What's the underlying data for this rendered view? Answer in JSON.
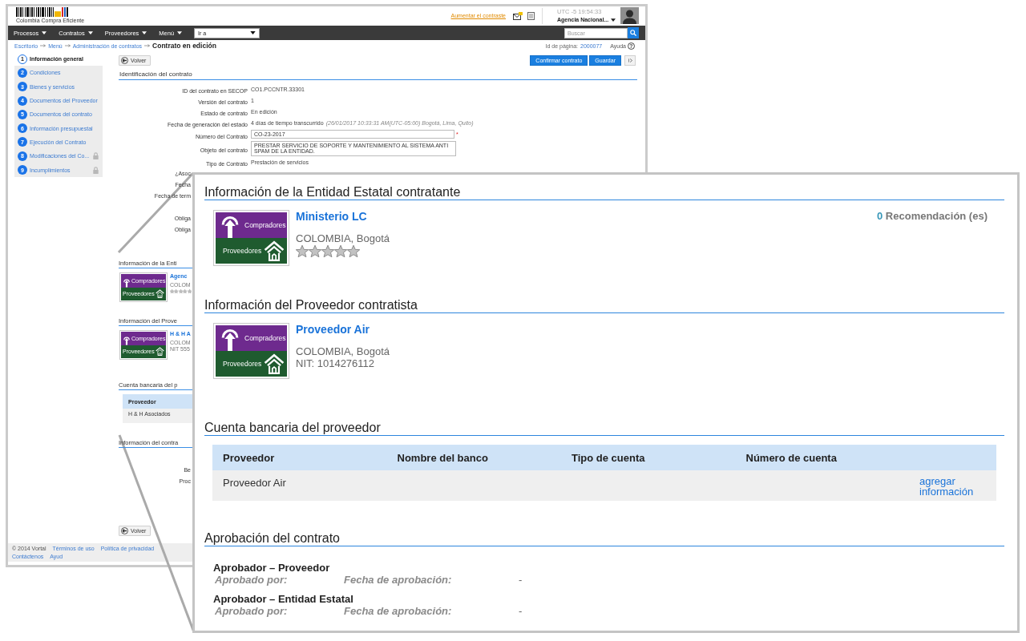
{
  "header": {
    "logo_caption": "Colombia Compra Eficiente",
    "contrast_link": "Aumentar el contraste",
    "clock": "UTC -5 19:54:33",
    "user": "Agencia Nacional..."
  },
  "nav": {
    "menus": [
      "Procesos",
      "Contratos",
      "Proveedores",
      "Menú"
    ],
    "goto": {
      "value": "Ir a"
    },
    "search": {
      "placeholder": "Buscar"
    }
  },
  "breadcrumb": {
    "links": [
      "Escritorio",
      "Menú",
      "Administración de contratos"
    ],
    "current": "Contrato en edición",
    "page_id_label": "Id de página:",
    "page_id": "2000077",
    "help": {
      "label": "Ayuda",
      "icon": "?"
    }
  },
  "sidebar": {
    "items": [
      {
        "number": "1",
        "label": "Información general",
        "selected": true,
        "locked": false
      },
      {
        "number": "2",
        "label": "Condiciones",
        "selected": false,
        "locked": false
      },
      {
        "number": "3",
        "label": "Bienes y servicios",
        "selected": false,
        "locked": false
      },
      {
        "number": "4",
        "label": "Documentos del Proveedor",
        "selected": false,
        "locked": false
      },
      {
        "number": "5",
        "label": "Documentos del contrato",
        "selected": false,
        "locked": false
      },
      {
        "number": "6",
        "label": "Información presupuestal",
        "selected": false,
        "locked": false
      },
      {
        "number": "7",
        "label": "Ejecución del Contrato",
        "selected": false,
        "locked": false
      },
      {
        "number": "8",
        "label": "Modificaciones del Co...",
        "selected": false,
        "locked": true
      },
      {
        "number": "9",
        "label": "Incumplimientos",
        "selected": false,
        "locked": true
      }
    ]
  },
  "toolbar": {
    "back": "Volver",
    "buttons": [
      {
        "kind": "primary",
        "label": "Confirmar contrato"
      },
      {
        "kind": "primary",
        "label": "Guardar"
      },
      {
        "kind": "menu"
      }
    ]
  },
  "identification": {
    "title": "Identificación del contrato",
    "fields": [
      {
        "kind": "text",
        "label": "ID del contrato en SECOP",
        "value": "CO1.PCCNTR.33301"
      },
      {
        "kind": "text",
        "label": "Versión del contrato",
        "value": "1"
      },
      {
        "kind": "text",
        "label": "Estado de contrato",
        "value": "En edición"
      },
      {
        "kind": "timestamp",
        "label": "Fecha de generación del estado",
        "value": "4 días de tiempo transcurrido",
        "detail": "(26/01/2017 10:33:31 AM(UTC-05:00) Bogotá, Lima, Quito)"
      },
      {
        "kind": "input",
        "label": "Número del Contrato",
        "value": "CO-23-2017",
        "required_mark": "*"
      },
      {
        "kind": "textarea",
        "label": "Objeto del contrato",
        "value": "PRESTAR SERVICIO DE SOPORTE Y MANTENIMIENTO AL SISTEMA ANTI SPAM DE LA ENTIDAD."
      },
      {
        "kind": "text",
        "label": "Tipo de Contrato",
        "value": "Prestación de servicios"
      }
    ],
    "covered_labels": [
      "¿Asoc",
      "Fecha",
      "Fecha de term",
      "Obliga",
      "Obliga"
    ]
  },
  "background_sections": {
    "entity": {
      "title": "Información de la Enti",
      "logo": {
        "top": "Compradores",
        "bottom": "Proveedores"
      },
      "name": "Agenc",
      "location": "COLOM",
      "stars": 0
    },
    "supplier": {
      "title": "Información del Prove",
      "logo": {
        "top": "Compradores",
        "bottom": "Proveedores"
      },
      "name": "H & H A",
      "lines": [
        "COLOM",
        "NIT 555"
      ]
    },
    "bank": {
      "title": "Cuenta bancaria del p",
      "column": "Proveedor",
      "row": "H & H Asociados"
    },
    "contract": {
      "title": "Información del contra",
      "covered_labels": [
        "Be",
        "Proc"
      ]
    }
  },
  "bottom_back": "Volver",
  "footer": {
    "copyright": "© 2014 Vortal",
    "links": [
      "Términos de uso",
      "Política de privacidad",
      "Contáctenos",
      "Ayud"
    ]
  },
  "zoom_panel": {
    "entity": {
      "title": "Información de la Entidad Estatal contratante",
      "logo": {
        "top": "Compradores",
        "bottom": "Proveedores"
      },
      "name": "Ministerio LC",
      "location": "COLOMBIA, Bogotá",
      "stars": 0,
      "recommendations": {
        "count": "0",
        "label": "Recomendación (es)"
      }
    },
    "supplier": {
      "title": "Información del Proveedor contratista",
      "logo": {
        "top": "Compradores",
        "bottom": "Proveedores"
      },
      "name": "Proveedor Air",
      "lines": [
        "COLOMBIA, Bogotá",
        "NIT: 1014276112"
      ]
    },
    "bank": {
      "title": "Cuenta bancaria del proveedor",
      "columns": [
        "Proveedor",
        "Nombre del banco",
        "Tipo de cuenta",
        "Número de cuenta"
      ],
      "rows": [
        {
          "provider": "Proveedor Air",
          "action": "agregar información"
        }
      ]
    },
    "approval": {
      "title": "Aprobación del contrato",
      "approvers": [
        {
          "title": "Aprobador – Proveedor",
          "by_label": "Aprobado por:",
          "date_label": "Fecha de aprobación:",
          "date": "-"
        },
        {
          "title": "Aprobador – Entidad Estatal",
          "by_label": "Aprobado por:",
          "date_label": "Fecha de aprobación:",
          "date": "-"
        }
      ]
    }
  }
}
